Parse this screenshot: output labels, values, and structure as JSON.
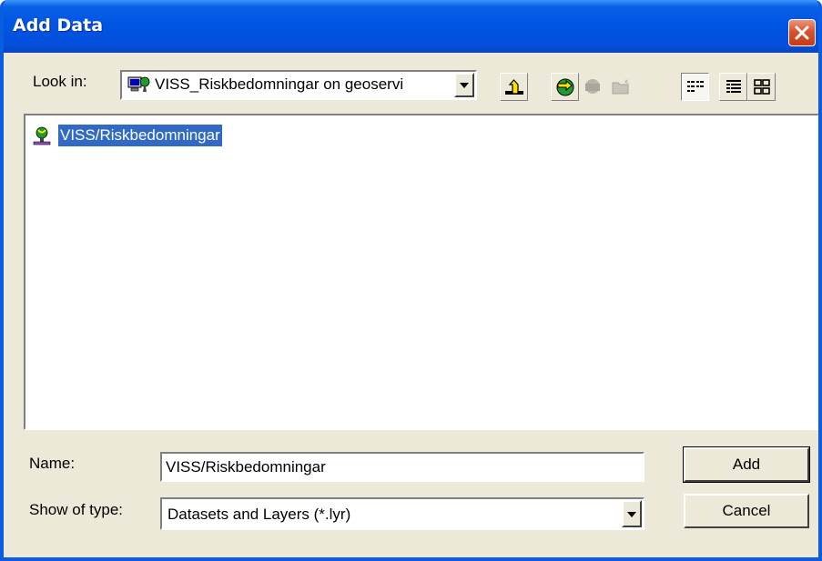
{
  "window": {
    "title": "Add Data",
    "accent": "#0054e3",
    "close_color": "#d9522b"
  },
  "look_in": {
    "label": "Look in:",
    "value": "VISS_Riskbedomningar on geoservi",
    "icon": "server-connection-icon"
  },
  "toolbar": [
    {
      "name": "up-one-level-icon"
    },
    {
      "name": "connect-folder-icon"
    },
    {
      "name": "disconnect-folder-icon"
    },
    {
      "name": "new-folder-icon"
    },
    {
      "name": "list-view-icon"
    },
    {
      "name": "details-view-icon"
    },
    {
      "name": "thumbnails-view-icon"
    }
  ],
  "files": [
    {
      "label": "VISS/Riskbedomningar",
      "icon": "map-service-icon",
      "selected": true
    }
  ],
  "name_field": {
    "label": "Name:",
    "value": "VISS/Riskbedomningar"
  },
  "type_field": {
    "label": "Show of type:",
    "value": "Datasets and Layers (*.lyr)"
  },
  "buttons": {
    "add": "Add",
    "cancel": "Cancel"
  },
  "selection_color": "#316ac5"
}
